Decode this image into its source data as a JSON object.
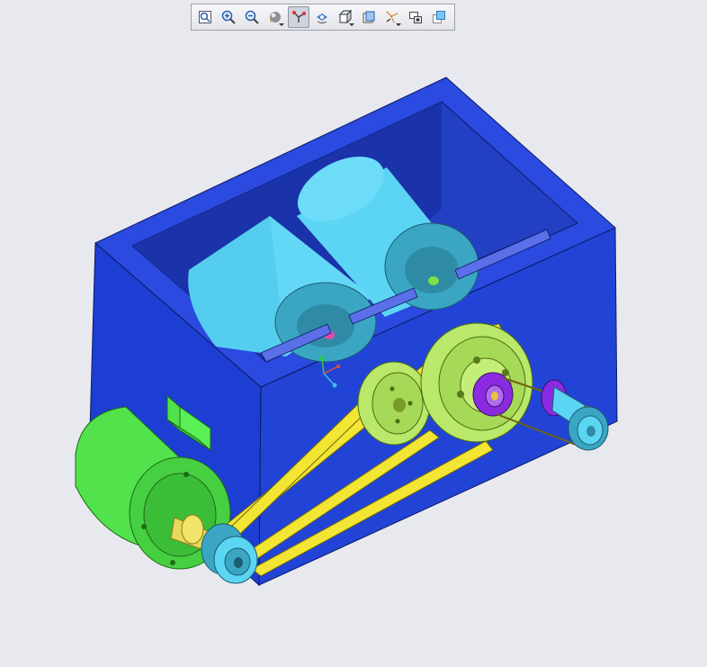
{
  "toolbar": {
    "buttons": [
      {
        "icon": "refit-icon",
        "active": false,
        "dropdown": false
      },
      {
        "icon": "zoom-in-icon",
        "active": false,
        "dropdown": false
      },
      {
        "icon": "zoom-out-icon",
        "active": false,
        "dropdown": false
      },
      {
        "icon": "display-style-icon",
        "active": false,
        "dropdown": true
      },
      {
        "icon": "datum-display-icon",
        "active": true,
        "dropdown": false
      },
      {
        "icon": "spin-center-icon",
        "active": false,
        "dropdown": false
      },
      {
        "icon": "saved-views-icon",
        "active": false,
        "dropdown": true
      },
      {
        "icon": "section-view-icon",
        "active": false,
        "dropdown": false
      },
      {
        "icon": "datum-filters-icon",
        "active": false,
        "dropdown": true
      },
      {
        "icon": "view-manager-icon",
        "active": false,
        "dropdown": false
      },
      {
        "icon": "appearance-icon",
        "active": false,
        "dropdown": false
      }
    ]
  },
  "colors": {
    "background": "#e8e9ee",
    "housing": "#1f3fcc",
    "housing_top": "#2a4ae0",
    "drum": "#5fd6f5",
    "motor": "#4fe24a",
    "belt": "#f2e533",
    "pulley": "#b9e86a",
    "shaft_purple": "#8a2be2"
  }
}
